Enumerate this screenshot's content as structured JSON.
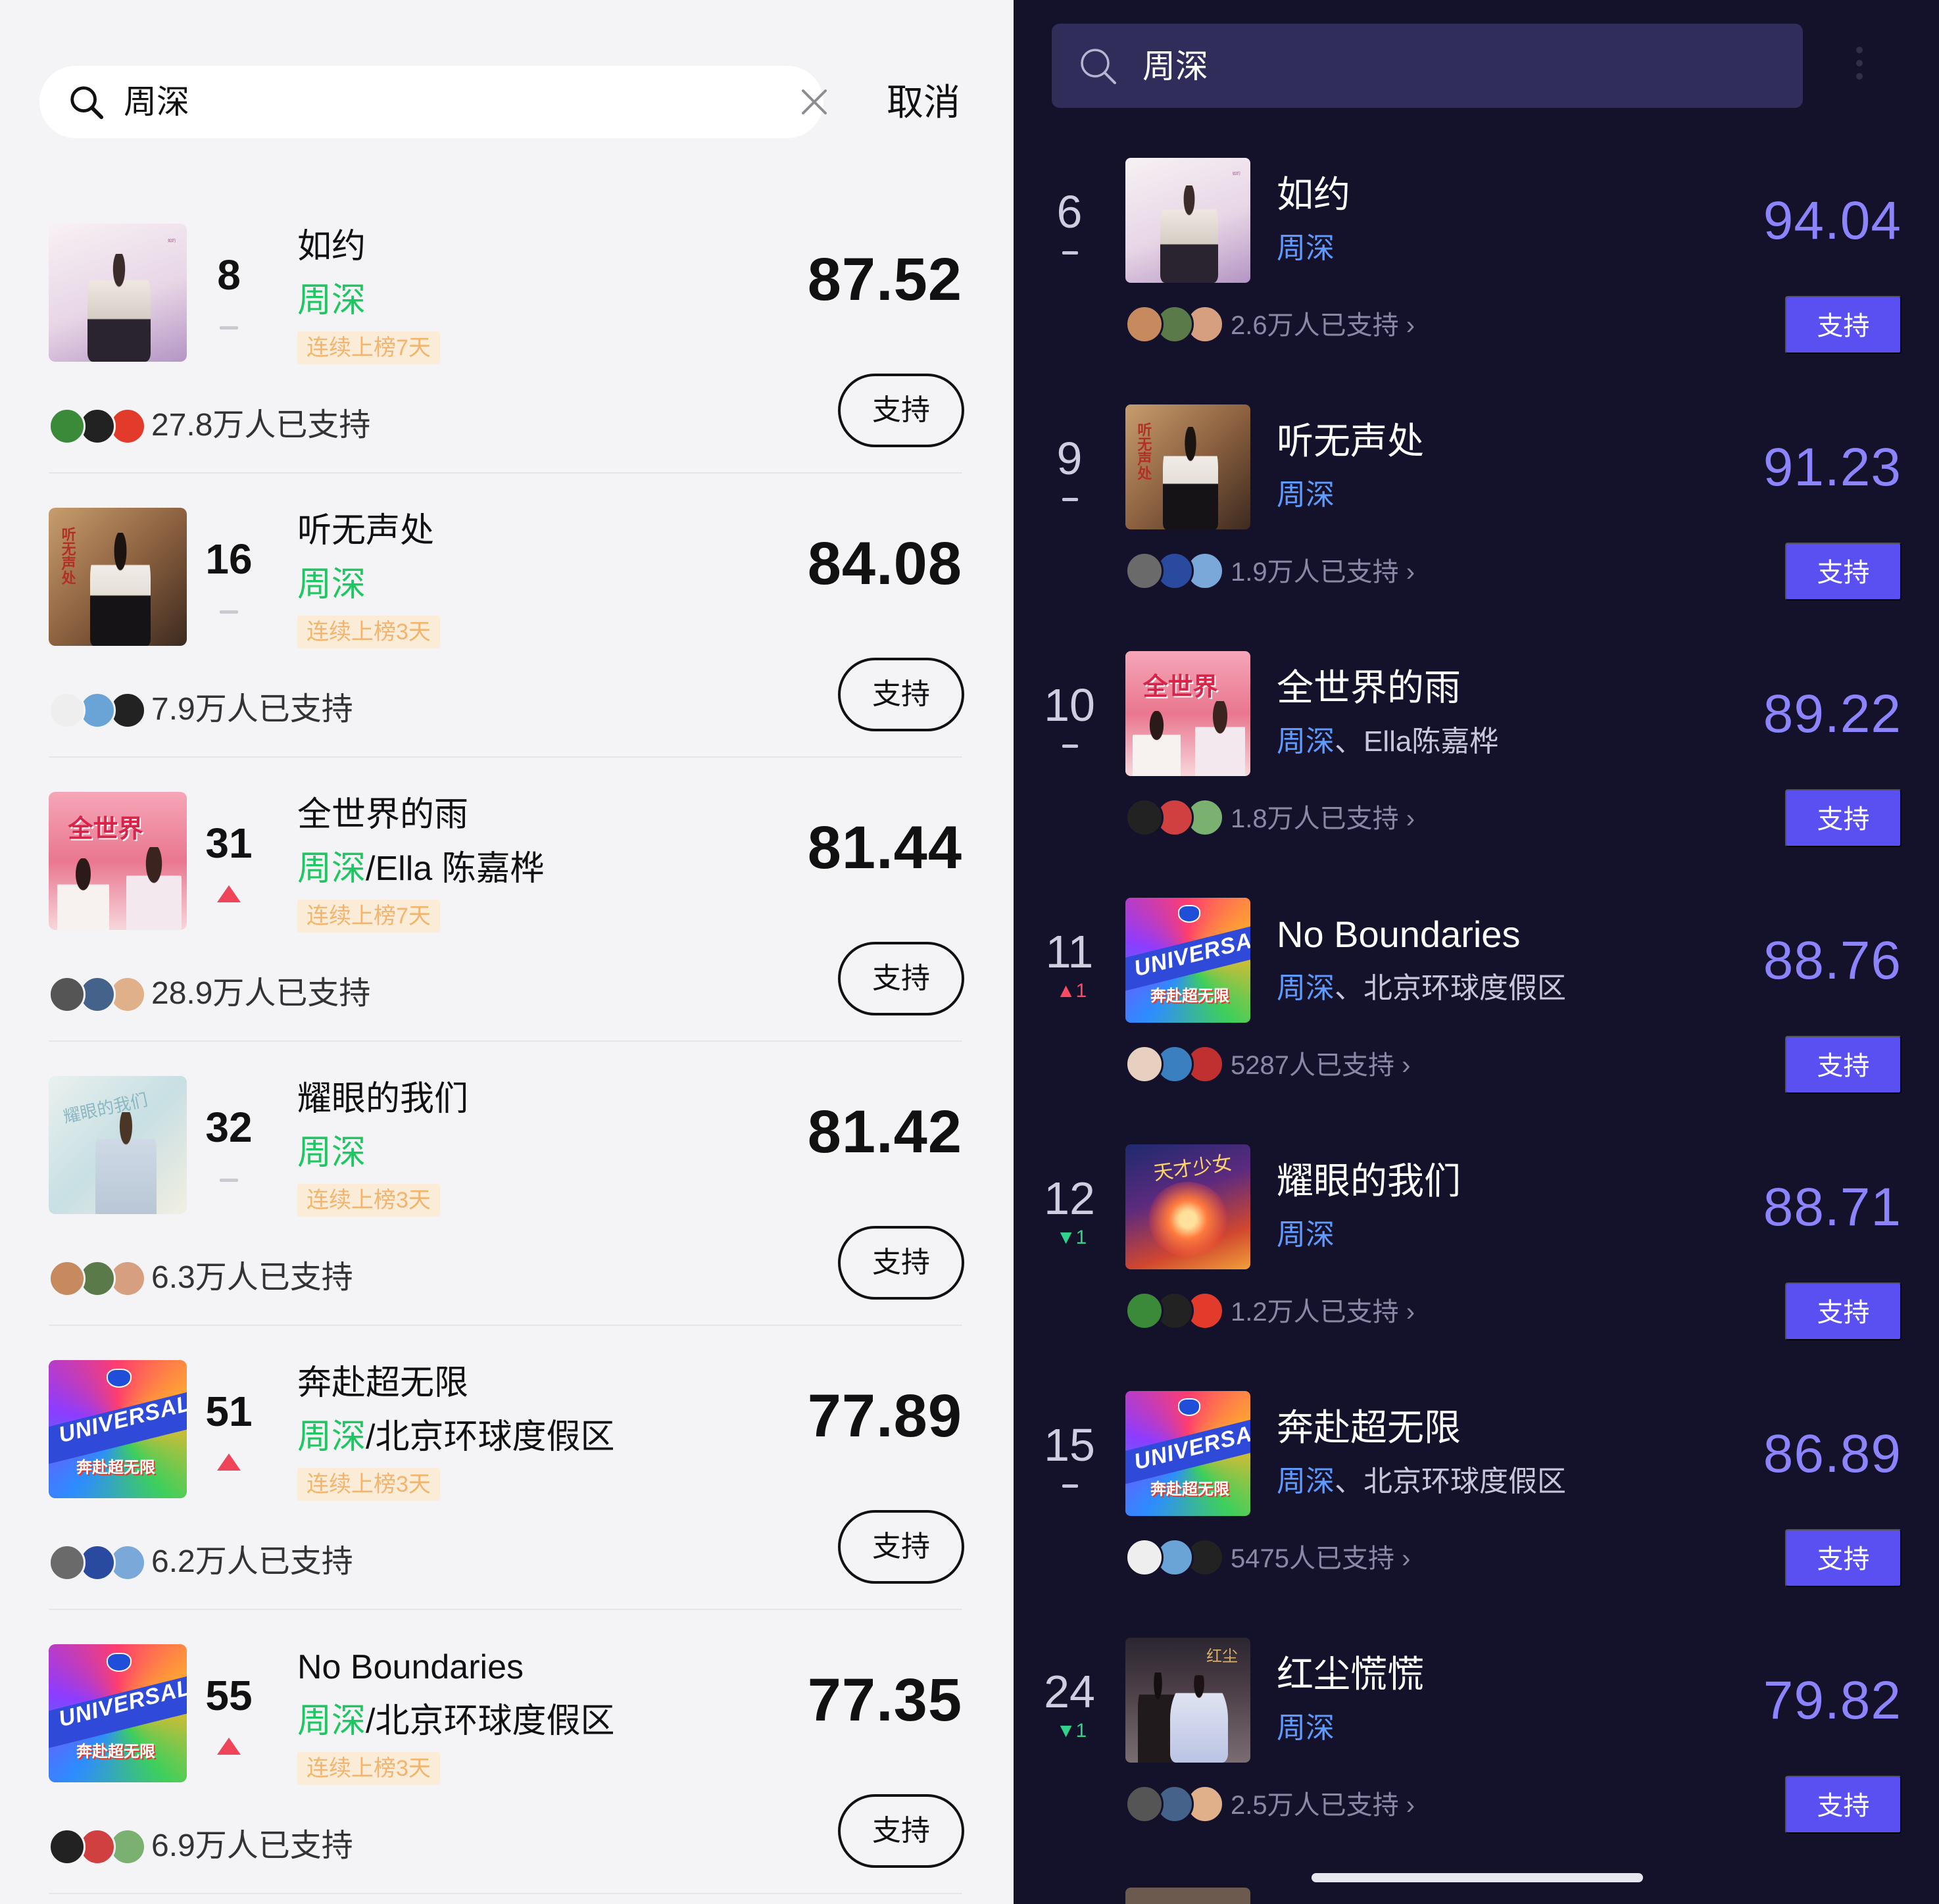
{
  "left": {
    "search": {
      "query": "周深",
      "cancel_label": "取消",
      "icons": [
        "search-icon",
        "clear-icon"
      ]
    },
    "rows": [
      {
        "rank": "8",
        "trend": "flat",
        "title": "如约",
        "artist_hl": "周深",
        "artist_rest": "",
        "streak": "连续上榜7天",
        "score": "87.52",
        "support_label": "支持",
        "support_count": "27.8万人已支持",
        "art": "ruyue"
      },
      {
        "rank": "16",
        "trend": "flat",
        "title": "听无声处",
        "artist_hl": "周深",
        "artist_rest": "",
        "streak": "连续上榜3天",
        "score": "84.08",
        "support_label": "支持",
        "support_count": "7.9万人已支持",
        "art": "ting"
      },
      {
        "rank": "31",
        "trend": "up",
        "title": "全世界的雨",
        "artist_hl": "周深",
        "artist_rest": "/Ella 陈嘉桦",
        "streak": "连续上榜7天",
        "score": "81.44",
        "support_label": "支持",
        "support_count": "28.9万人已支持",
        "art": "rain"
      },
      {
        "rank": "32",
        "trend": "flat",
        "title": "耀眼的我们",
        "artist_hl": "周深",
        "artist_rest": "",
        "streak": "连续上榜3天",
        "score": "81.42",
        "support_label": "支持",
        "support_count": "6.3万人已支持",
        "art": "yao"
      },
      {
        "rank": "51",
        "trend": "up",
        "title": "奔赴超无限",
        "artist_hl": "周深",
        "artist_rest": "/北京环球度假区",
        "streak": "连续上榜3天",
        "score": "77.89",
        "support_label": "支持",
        "support_count": "6.2万人已支持",
        "art": "uni"
      },
      {
        "rank": "55",
        "trend": "up",
        "title": "No Boundaries",
        "artist_hl": "周深",
        "artist_rest": "/北京环球度假区",
        "streak": "连续上榜3天",
        "score": "77.35",
        "support_label": "支持",
        "support_count": "6.9万人已支持",
        "art": "uni"
      }
    ]
  },
  "right": {
    "search": {
      "query": "周深",
      "icons": [
        "search-icon",
        "more-icon"
      ]
    },
    "rows": [
      {
        "rank": "6",
        "trend": "flat",
        "trend_text": "",
        "title": "如约",
        "artist_hl": "周深",
        "artist_rest": "",
        "score": "94.04",
        "support_label": "支持",
        "support_count": "2.6万人已支持 ›",
        "art": "ruyue"
      },
      {
        "rank": "9",
        "trend": "flat",
        "trend_text": "",
        "title": "听无声处",
        "artist_hl": "周深",
        "artist_rest": "",
        "score": "91.23",
        "support_label": "支持",
        "support_count": "1.9万人已支持 ›",
        "art": "ting"
      },
      {
        "rank": "10",
        "trend": "flat",
        "trend_text": "",
        "title": "全世界的雨",
        "artist_hl": "周深",
        "artist_rest": "、Ella陈嘉桦",
        "score": "89.22",
        "support_label": "支持",
        "support_count": "1.8万人已支持 ›",
        "art": "rain"
      },
      {
        "rank": "11",
        "trend": "up",
        "trend_text": "▲1",
        "title": "No Boundaries",
        "artist_hl": "周深",
        "artist_rest": "、北京环球度假区",
        "score": "88.76",
        "support_label": "支持",
        "support_count": "5287人已支持 ›",
        "art": "uni"
      },
      {
        "rank": "12",
        "trend": "down",
        "trend_text": "▼1",
        "title": "耀眼的我们",
        "artist_hl": "周深",
        "artist_rest": "",
        "score": "88.71",
        "support_label": "支持",
        "support_count": "1.2万人已支持 ›",
        "art": "yao2"
      },
      {
        "rank": "15",
        "trend": "flat",
        "trend_text": "",
        "title": "奔赴超无限",
        "artist_hl": "周深",
        "artist_rest": "、北京环球度假区",
        "score": "86.89",
        "support_label": "支持",
        "support_count": "5475人已支持 ›",
        "art": "uni"
      },
      {
        "rank": "24",
        "trend": "down",
        "trend_text": "▼1",
        "title": "红尘慌慌",
        "artist_hl": "周深",
        "artist_rest": "",
        "score": "79.82",
        "support_label": "支持",
        "support_count": "2.5万人已支持 ›",
        "art": "hong"
      }
    ]
  },
  "colors": {
    "left_bg": "#f4f4f7",
    "right_bg": "#14122b",
    "artist_green": "#1fc763",
    "artist_blue": "#5f9bff",
    "score_purple": "#8c84ff",
    "support_btn_purple": "#5a4ff0",
    "trend_up_red": "#f0445b",
    "trend_down_green": "#2fd38a",
    "streak_bg": "#fbecd8",
    "streak_text": "#f2b46e"
  }
}
